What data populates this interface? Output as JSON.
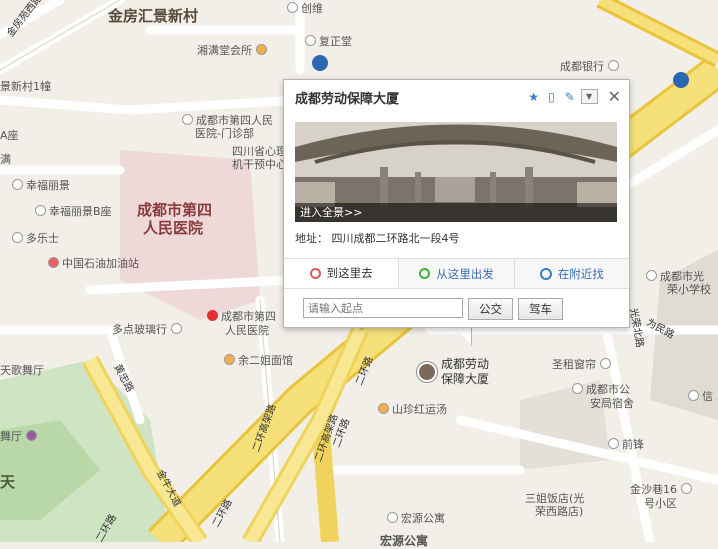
{
  "popup": {
    "title": "成都劳动保障大厦",
    "pano_caption": "进入全景>>",
    "address_label": "地址：",
    "address_value": "四川成都二环路北一段4号",
    "tabs": [
      {
        "label": "到这里去"
      },
      {
        "label": "从这里出发"
      },
      {
        "label": "在附近找"
      }
    ],
    "input_placeholder": "请输入起点",
    "btn_bus": "公交",
    "btn_drive": "驾车",
    "icons": [
      "star-icon",
      "phone-icon",
      "edit-icon",
      "dropdown-icon",
      "close-icon"
    ]
  },
  "marker": {
    "line1": "成都劳动",
    "line2": "保障大厦"
  },
  "map": {
    "districts": [
      {
        "text": "金房汇景新村"
      },
      {
        "text": "天"
      }
    ],
    "hospital": {
      "line1": "成都市第四",
      "line2": "人民医院"
    },
    "pois": [
      {
        "text": "创维"
      },
      {
        "text": "复正堂"
      },
      {
        "text": "湘满堂会所"
      },
      {
        "text": "成都银行"
      },
      {
        "text": "景新村1幢"
      },
      {
        "text": "成都市第四人民"
      },
      {
        "text": "医院-门诊部"
      },
      {
        "text": "四川省心理"
      },
      {
        "text": "机干预中心"
      },
      {
        "text": "幸福丽景"
      },
      {
        "text": "幸福丽景B座"
      },
      {
        "text": "多乐士"
      },
      {
        "text": "中国石油加油站"
      },
      {
        "text": "多点玻璃行"
      },
      {
        "text": "成都市第四"
      },
      {
        "text": "人民医院"
      },
      {
        "text": "余二姐面馆"
      },
      {
        "text": "天歌舞厅"
      },
      {
        "text": "舞厅"
      },
      {
        "text": "山珍红运汤"
      },
      {
        "text": "圣租窗帘"
      },
      {
        "text": "成都市公"
      },
      {
        "text": "安局宿舍"
      },
      {
        "text": "信"
      },
      {
        "text": "前锋"
      },
      {
        "text": "金沙巷16"
      },
      {
        "text": "号小区"
      },
      {
        "text": "三姐饭店(光"
      },
      {
        "text": "荣西路店)"
      },
      {
        "text": "宏源公寓"
      },
      {
        "text": "宏源公寓"
      },
      {
        "text": "成都市光"
      },
      {
        "text": "荣小学校"
      },
      {
        "text": "A座"
      },
      {
        "text": "满"
      }
    ],
    "roads": [
      {
        "text": "金房苑西路"
      },
      {
        "text": "二环路"
      },
      {
        "text": "二环高架路"
      },
      {
        "text": "二环高架路"
      },
      {
        "text": "二环路"
      },
      {
        "text": "金牛大道"
      },
      {
        "text": "黄忠路"
      },
      {
        "text": "光荣北路"
      },
      {
        "text": "为民路"
      },
      {
        "text": "二环路"
      },
      {
        "text": "二环路"
      }
    ]
  }
}
